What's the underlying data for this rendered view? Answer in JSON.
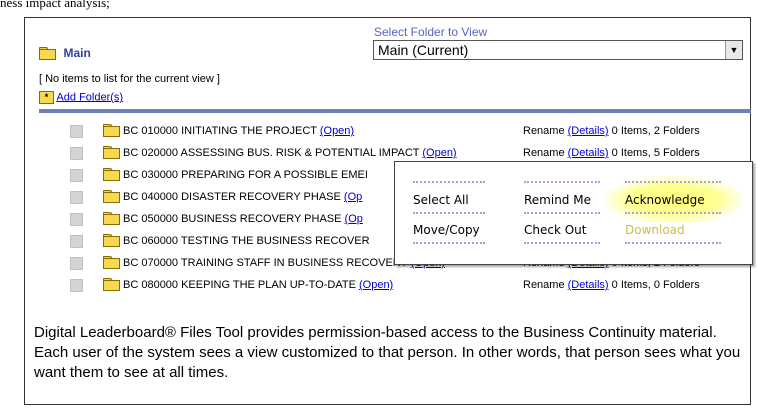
{
  "top_text": "ness impact analysis;",
  "header": {
    "folder_title": "Main",
    "select_label": "Select Folder to View",
    "select_value": "Main (Current)"
  },
  "no_items_text": "[ No items to list for the current view ]",
  "add_folder_label": "Add Folder(s)",
  "folders": [
    {
      "name": "BC 010000 INITIATING THE PROJECT",
      "open": "(Open)",
      "rename": "Rename",
      "details": "(Details)",
      "counts": "0 Items, 2 Folders"
    },
    {
      "name": "BC 020000 ASSESSING BUS. RISK & POTENTIAL IMPACT",
      "open": "(Open)",
      "rename": "Rename",
      "details": "(Details)",
      "counts": "0 Items, 5 Folders"
    },
    {
      "name": "BC 030000 PREPARING FOR A POSSIBLE EMEI",
      "open": "",
      "rename": "",
      "details": "",
      "counts": ""
    },
    {
      "name": "BC 040000 DISASTER RECOVERY PHASE",
      "open": "(Op",
      "rename": "",
      "details": "",
      "counts": ""
    },
    {
      "name": "BC 050000 BUSINESS RECOVERY PHASE",
      "open": "(Op",
      "rename": "",
      "details": "",
      "counts": ""
    },
    {
      "name": "BC 060000 TESTING THE BUSINESS RECOVER",
      "open": "",
      "rename": "",
      "details": "",
      "counts": ""
    },
    {
      "name": "BC 070000 TRAINING STAFF IN BUSINESS RECOVERY",
      "open": "(Open)",
      "rename": "Rename",
      "details": "(Details)",
      "counts": "0 Items, 2 Folders"
    },
    {
      "name": "BC 080000 KEEPING THE PLAN UP-TO-DATE",
      "open": "(Open)",
      "rename": "Rename",
      "details": "(Details)",
      "counts": "0 Items, 0 Folders"
    }
  ],
  "popup_menu": {
    "select_all": "Select All",
    "remind_me": "Remind Me",
    "acknowledge": "Acknowledge",
    "move_copy": "Move/Copy",
    "check_out": "Check Out",
    "download": "Download",
    "download_color": "#c7c04a",
    "highlight_color": "#ffff66"
  },
  "caption": "Digital Leaderboard® Files Tool provides permission-based access to the Business Continuity material. Each user of the system sees a view customized to that person. In other words, that person sees what you want them to see at all times.",
  "colors": {
    "main_title": "#2e3f9e",
    "select_label": "#5566bb",
    "divider_bar": "#6f7fb8",
    "link": "#0000cc"
  }
}
